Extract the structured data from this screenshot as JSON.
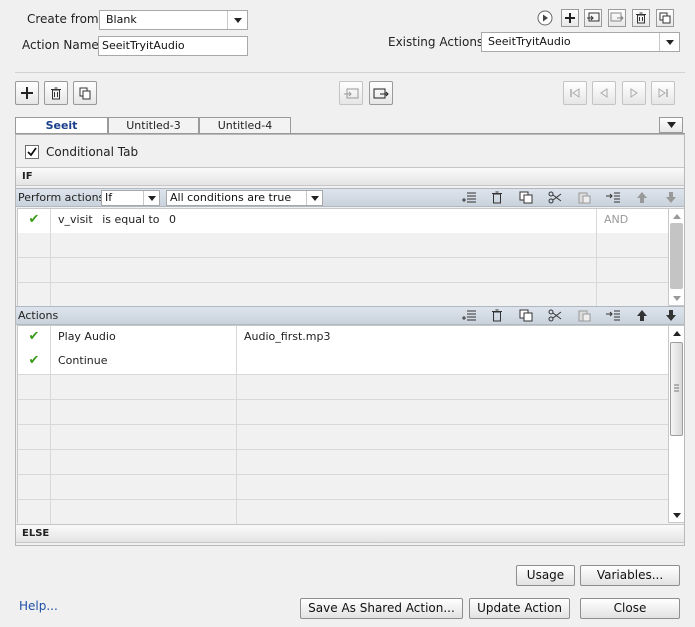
{
  "header": {
    "create_from_label": "Create from:",
    "create_from_value": "Blank",
    "action_name_label": "Action Name:",
    "action_name_value": "SeeitTryitAudio",
    "existing_actions_label": "Existing Actions:",
    "existing_actions_value": "SeeitTryitAudio",
    "top_icons": [
      "play-icon",
      "add-icon",
      "import-icon",
      "export-icon",
      "delete-icon",
      "duplicate-icon"
    ]
  },
  "toolbar": {
    "left_icons": [
      "add-icon",
      "trash-icon",
      "copy-icon"
    ],
    "center_icons": [
      "import-icon",
      "export-icon"
    ],
    "nav_icons": [
      "first-icon",
      "previous-icon",
      "next-icon",
      "last-icon"
    ]
  },
  "tabs": [
    {
      "label": "Seeit",
      "active": true
    },
    {
      "label": "Untitled-3",
      "active": false
    },
    {
      "label": "Untitled-4",
      "active": false
    }
  ],
  "conditional_tab": {
    "label": "Conditional Tab",
    "checked": true
  },
  "if_section": {
    "title": "IF",
    "perform_actions_label": "Perform actions:",
    "perform_mode": "If",
    "condition_mode": "All conditions are true",
    "conditions": [
      {
        "check": "✔",
        "variable": "v_visit",
        "operator": "is equal to",
        "value": "0",
        "logic": "AND"
      }
    ],
    "empty_rows": 3
  },
  "actions_section": {
    "title": "Actions",
    "rows": [
      {
        "check": "✔",
        "action": "Play Audio",
        "target": "Audio_first.mp3"
      },
      {
        "check": "✔",
        "action": "Continue",
        "target": ""
      }
    ],
    "empty_rows": 6
  },
  "else_section": {
    "title": "ELSE"
  },
  "footer": {
    "help": "Help...",
    "usage": "Usage",
    "variables": "Variables...",
    "save_shared": "Save As Shared Action...",
    "update": "Update Action",
    "close": "Close"
  },
  "colors": {
    "check": "#3c9a1a",
    "active_tab_text": "#1a3e8c",
    "grid_header": "#d3dae3",
    "help_link": "#1f4fa8"
  }
}
